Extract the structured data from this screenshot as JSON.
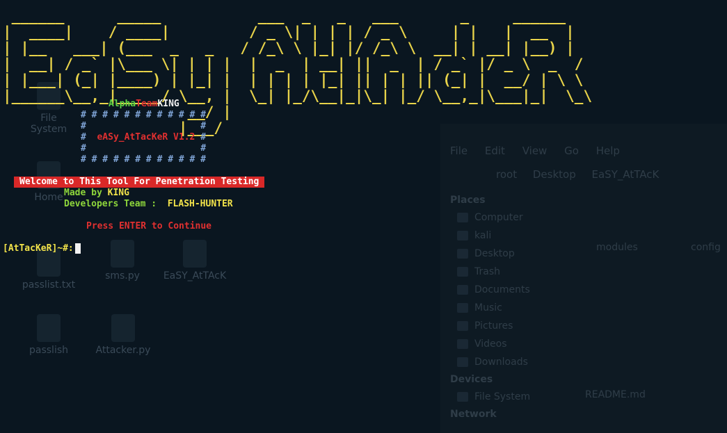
{
  "banner": {
    "ascii": " ______      _____           ___  _   _   ___       _     ______ \n|  ____|    / ____|         / _ \\| | | | / _ \\     | |   |  __  |\n| |__   ___| (___  _   _   / /_\\ \\ |_| |/ /_\\ \\  __| | __| |__) |\n|  __| / _` |\\___ \\| | | |  |  _  | __| ||  _  | / _` |/ _ \\  _  / \n| |___| (_| |____) | |_| |  | | | | |_| || | | || (_| |  __/ | \\ \\ \n|______\\__,_|_____/ \\__, |  \\_| |_/\\__|_|\\_| |_/ \\__,_|\\___|_|  \\_\\\n                     __/ |                                         \n                    |___/                                          ",
    "color": "#e8d34a"
  },
  "credit": {
    "part1": "Alpha",
    "part2": "Team",
    "part3": "KING"
  },
  "box": {
    "border": "# # # # # # # # # # # #",
    "side": "#",
    "gap": "                     ",
    "version": "eASy_AtTacKeR V1.2"
  },
  "welcome": "Welcome to This Tool For Penetration Testing",
  "made_by": {
    "label": "Made by ",
    "name": "KING"
  },
  "developers": {
    "label": "Developers Team :  ",
    "name": "FLASH-HUNTER"
  },
  "press_enter": "Press ENTER to Continue",
  "prompt": "[AtTacKeR]~#:",
  "desktop_icons": [
    {
      "label": "File System"
    },
    {
      "label": "Home"
    },
    {
      "label": "passlist.txt"
    },
    {
      "label": "sms.py"
    },
    {
      "label": "EaSY_AtTAcK"
    },
    {
      "label": "passlish"
    },
    {
      "label": "Attacker.py"
    }
  ],
  "file_manager": {
    "menu": [
      "File",
      "Edit",
      "View",
      "Go",
      "Help"
    ],
    "path": [
      "root",
      "Desktop",
      "EaSY_AtTAcK"
    ],
    "places_header": "Places",
    "places": [
      "Computer",
      "kali",
      "Desktop",
      "Trash",
      "Documents",
      "Music",
      "Pictures",
      "Videos",
      "Downloads"
    ],
    "devices_header": "Devices",
    "devices": [
      "File System"
    ],
    "network_header": "Network",
    "files": [
      "modules",
      "config",
      "README.md"
    ]
  },
  "colors": {
    "background": "#0a1620",
    "banner": "#e8d34a",
    "green": "#5fd444",
    "red": "#e03030",
    "yellow": "#f2e34a",
    "box": "#7fa4d6"
  }
}
